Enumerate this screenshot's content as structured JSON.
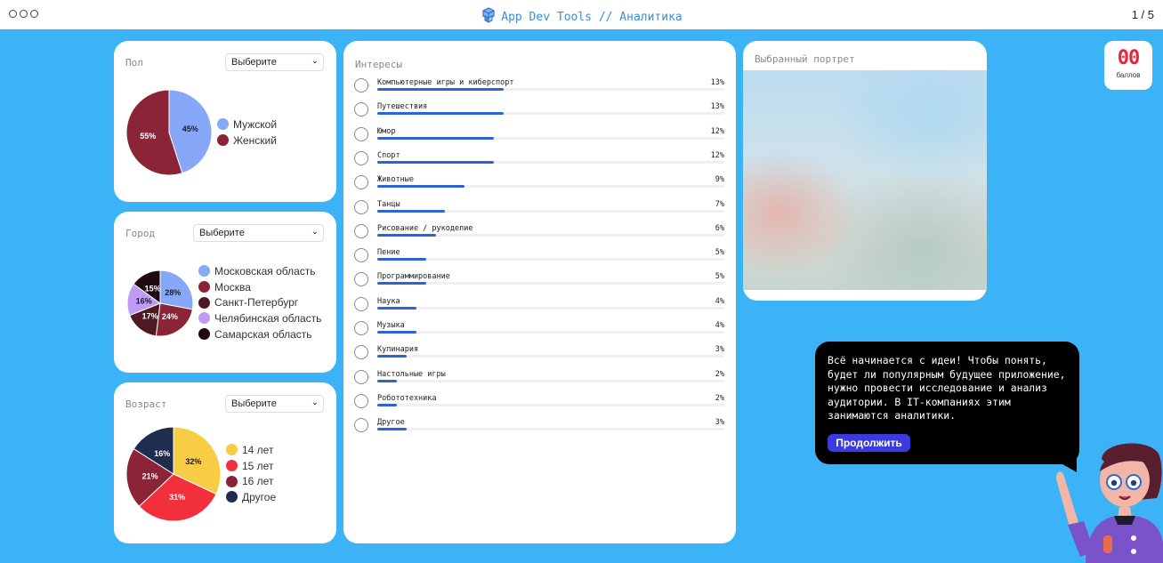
{
  "window": {
    "title": "App Dev Tools // Аналитика",
    "page_indicator": "1 / 5",
    "logo_icon": "cubes-logo-icon",
    "menu_icon": "three-dots-icon"
  },
  "gender": {
    "label": "Пол",
    "select_value": "Выберите",
    "chart_data": {
      "type": "pie",
      "categories": [
        "Мужской",
        "Женский"
      ],
      "values": [
        45,
        55
      ],
      "value_labels": [
        "45%",
        "55%"
      ],
      "colors": [
        "#87a7f8",
        "#8a2436"
      ]
    }
  },
  "city": {
    "label": "Город",
    "select_value": "Выберите",
    "chart_data": {
      "type": "pie",
      "categories": [
        "Московская область",
        "Москва",
        "Санкт-Петербург",
        "Челябинская область",
        "Самарская область"
      ],
      "values": [
        28,
        24,
        17,
        16,
        15
      ],
      "value_labels": [
        "28%",
        "24%",
        "17%",
        "16%",
        "15%"
      ],
      "colors": [
        "#87a7f8",
        "#8a2436",
        "#4d1a24",
        "#c09bf5",
        "#1e0a10"
      ]
    }
  },
  "age": {
    "label": "Возраст",
    "select_value": "Выберите",
    "chart_data": {
      "type": "pie",
      "categories": [
        "14 лет",
        "15 лет",
        "16 лет",
        "Другое"
      ],
      "values": [
        32,
        31,
        21,
        16
      ],
      "value_labels": [
        "32%",
        "31%",
        "21%",
        "16%"
      ],
      "colors": [
        "#f7cd45",
        "#f2303b",
        "#8a2436",
        "#1f2d4f"
      ]
    }
  },
  "interests": {
    "label": "Интересы",
    "items": [
      {
        "name": "Компьютерные игры и киберспорт",
        "value": 13,
        "pct": "13%"
      },
      {
        "name": "Путешествия",
        "value": 13,
        "pct": "13%"
      },
      {
        "name": "Юмор",
        "value": 12,
        "pct": "12%"
      },
      {
        "name": "Спорт",
        "value": 12,
        "pct": "12%"
      },
      {
        "name": "Животные",
        "value": 9,
        "pct": "9%"
      },
      {
        "name": "Танцы",
        "value": 7,
        "pct": "7%"
      },
      {
        "name": "Рисование / рукоделие",
        "value": 6,
        "pct": "6%"
      },
      {
        "name": "Пение",
        "value": 5,
        "pct": "5%"
      },
      {
        "name": "Программирование",
        "value": 5,
        "pct": "5%"
      },
      {
        "name": "Наука",
        "value": 4,
        "pct": "4%"
      },
      {
        "name": "Музыка",
        "value": 4,
        "pct": "4%"
      },
      {
        "name": "Кулинария",
        "value": 3,
        "pct": "3%"
      },
      {
        "name": "Настольные игры",
        "value": 2,
        "pct": "2%"
      },
      {
        "name": "Робототехника",
        "value": 2,
        "pct": "2%"
      },
      {
        "name": "Другое",
        "value": 3,
        "pct": "3%"
      }
    ],
    "bar_color": "#2d63d6"
  },
  "portrait": {
    "label": "Выбранный портрет"
  },
  "score": {
    "value": "00",
    "unit": "баллов",
    "color": "#e8233f"
  },
  "guide": {
    "message": "Всё начинается с идеи! Чтобы понять, будет ли популярным будущее приложение, нужно провести исследование и анализ аудитории. В IT-компаниях этим занимаются аналитики.",
    "continue_label": "Продолжить",
    "accent": "#3a3adf"
  }
}
